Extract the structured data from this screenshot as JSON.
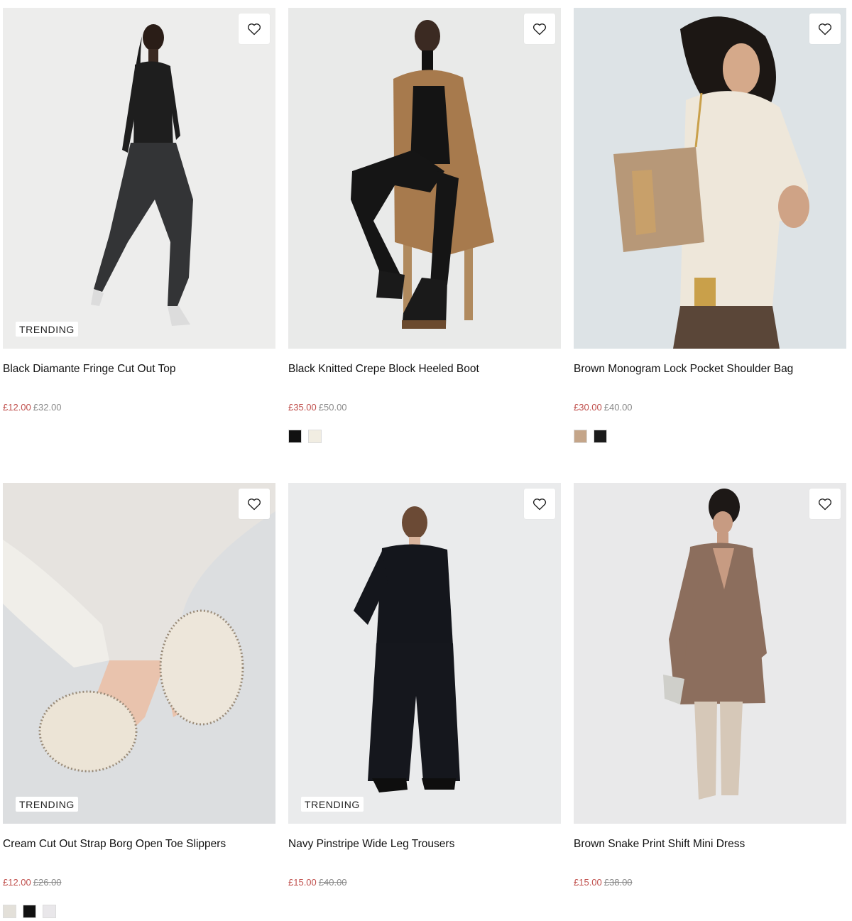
{
  "products": [
    {
      "name": "Black Diamante Fringe Cut Out Top",
      "badge": "TRENDING",
      "sale_price": "£12.00",
      "original_price": "£32.00",
      "swatches": [],
      "bg": "#ededec"
    },
    {
      "name": "Black Knitted Crepe Block Heeled Boot",
      "badge": "",
      "sale_price": "£35.00",
      "original_price": "£50.00",
      "swatches": [
        "#111111",
        "#f1ede2"
      ],
      "bg": "#e9eae9"
    },
    {
      "name": "Brown Monogram Lock Pocket Shoulder Bag",
      "badge": "",
      "sale_price": "£30.00",
      "original_price": "£40.00",
      "swatches": [
        "#c4a589",
        "#1b1b1b"
      ],
      "bg": "#dde3e6"
    },
    {
      "name": "Cream Cut Out Strap Borg Open Toe Slippers",
      "badge": "TRENDING",
      "sale_price": "£12.00",
      "original_price": "£26.00",
      "swatches": [
        "#e3e0d9",
        "#111111",
        "#e9e7ea"
      ],
      "bg": "#dcdee0"
    },
    {
      "name": "Navy Pinstripe Wide Leg Trousers",
      "badge": "TRENDING",
      "sale_price": "£15.00",
      "original_price": "£40.00",
      "swatches": [],
      "bg": "#eaebec"
    },
    {
      "name": "Brown Snake Print Shift Mini Dress",
      "badge": "",
      "sale_price": "£15.00",
      "original_price": "£38.00",
      "swatches": [],
      "bg": "#e9e9ea"
    }
  ],
  "wishlist_icon": "heart-outline-icon",
  "colors": {
    "sale": "#c0504d",
    "original": "#8a8a8a"
  }
}
